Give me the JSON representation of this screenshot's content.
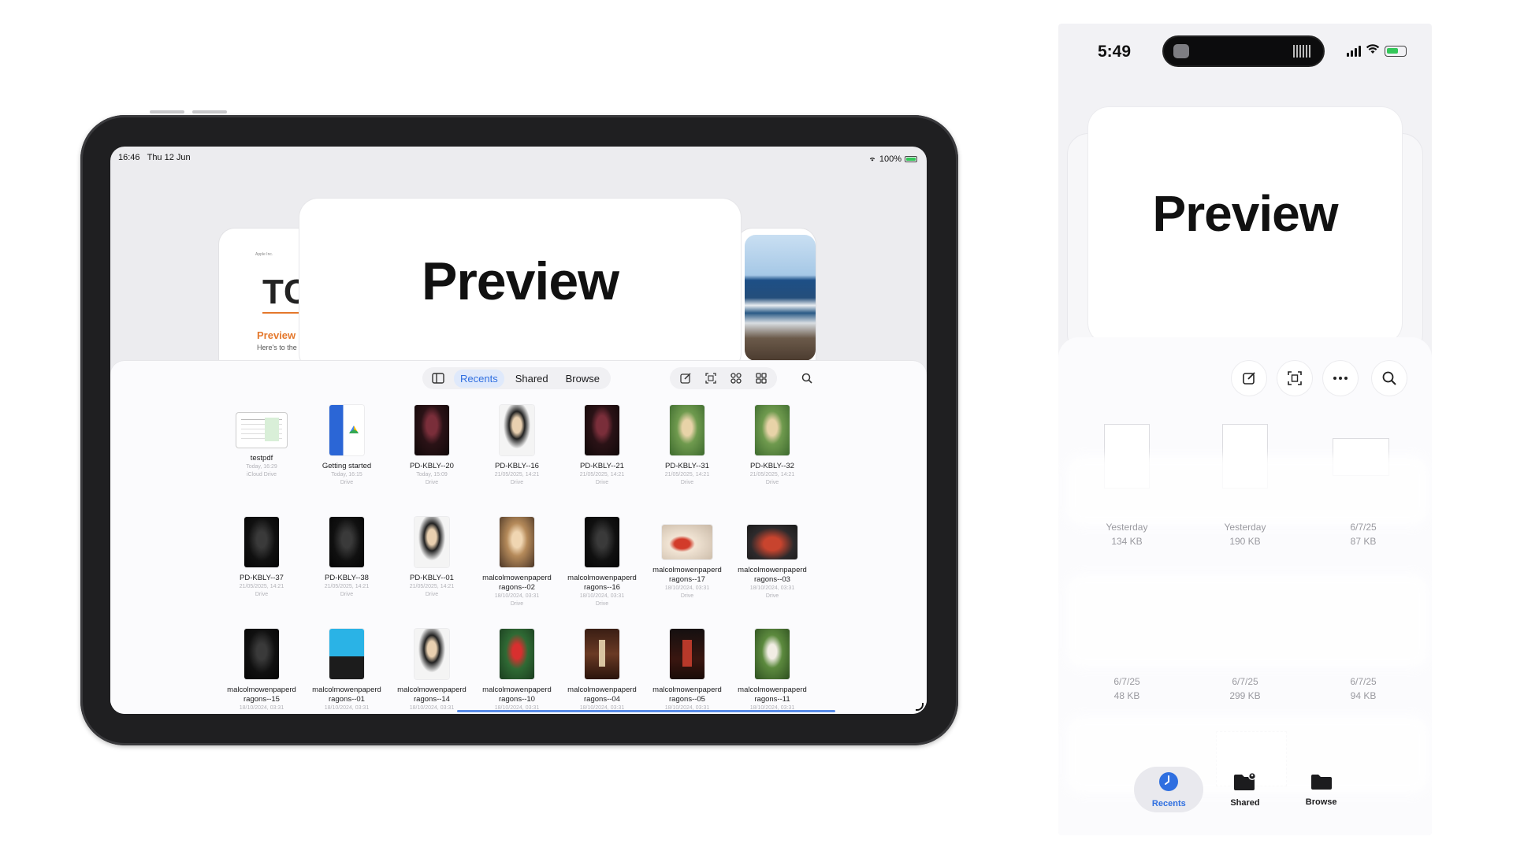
{
  "ipad": {
    "status": {
      "time": "16:46",
      "date": "Thu 12 Jun",
      "battery": "100%"
    },
    "left_card": {
      "small": "Apple Inc.",
      "big": "TC",
      "orange": "Preview",
      "sub": "Here's to the"
    },
    "center_card_title": "Preview",
    "toolbar": {
      "sidebar_icon": "sidebar-icon",
      "tabs": [
        "Recents",
        "Shared",
        "Browse"
      ],
      "active_tab": "Recents",
      "actions": [
        "compose-icon",
        "scan-icon",
        "group-icon",
        "grid-view-icon"
      ],
      "search_icon": "search-icon"
    },
    "files": [
      {
        "name": "testpdf",
        "meta1": "Today, 16:29",
        "meta2": "iCloud Drive"
      },
      {
        "name": "Getting started",
        "meta1": "Today, 16:15",
        "meta2": "Drive"
      },
      {
        "name": "PD-KBLY--20",
        "meta1": "Today, 15:09",
        "meta2": "Drive"
      },
      {
        "name": "PD-KBLY--16",
        "meta1": "21/05/2025, 14:21",
        "meta2": "Drive"
      },
      {
        "name": "PD-KBLY--21",
        "meta1": "21/05/2025, 14:21",
        "meta2": "Drive"
      },
      {
        "name": "PD-KBLY--31",
        "meta1": "21/05/2025, 14:21",
        "meta2": "Drive"
      },
      {
        "name": "PD-KBLY--32",
        "meta1": "21/05/2025, 14:21",
        "meta2": "Drive"
      },
      {
        "name": "PD-KBLY--37",
        "meta1": "21/05/2025, 14:21",
        "meta2": "Drive"
      },
      {
        "name": "PD-KBLY--38",
        "meta1": "21/05/2025, 14:21",
        "meta2": "Drive"
      },
      {
        "name": "PD-KBLY--01",
        "meta1": "21/05/2025, 14:21",
        "meta2": "Drive"
      },
      {
        "name": "malcolmowenpaperd ragons--02",
        "meta1": "18/10/2024, 03:31",
        "meta2": "Drive"
      },
      {
        "name": "malcolmowenpaperd ragons--16",
        "meta1": "18/10/2024, 03:31",
        "meta2": "Drive"
      },
      {
        "name": "malcolmowenpaperd ragons--17",
        "meta1": "18/10/2024, 03:31",
        "meta2": "Drive"
      },
      {
        "name": "malcolmowenpaperd ragons--03",
        "meta1": "18/10/2024, 03:31",
        "meta2": "Drive"
      },
      {
        "name": "malcolmowenpaperd ragons--15",
        "meta1": "18/10/2024, 03:31",
        "meta2": ""
      },
      {
        "name": "malcolmowenpaperd ragons--01",
        "meta1": "18/10/2024, 03:31",
        "meta2": ""
      },
      {
        "name": "malcolmowenpaperd ragons--14",
        "meta1": "18/10/2024, 03:31",
        "meta2": ""
      },
      {
        "name": "malcolmowenpaperd ragons--10",
        "meta1": "18/10/2024, 03:31",
        "meta2": ""
      },
      {
        "name": "malcolmowenpaperd ragons--04",
        "meta1": "18/10/2024, 03:31",
        "meta2": ""
      },
      {
        "name": "malcolmowenpaperd ragons--05",
        "meta1": "18/10/2024, 03:31",
        "meta2": ""
      },
      {
        "name": "malcolmowenpaperd ragons--11",
        "meta1": "18/10/2024, 03:31",
        "meta2": ""
      }
    ]
  },
  "iphone": {
    "status": {
      "time": "5:49"
    },
    "card_title": "Preview",
    "toolbar": [
      "compose-icon",
      "scan-icon",
      "more-icon",
      "search-icon"
    ],
    "items": [
      {
        "date": "Yesterday",
        "size": "134 KB"
      },
      {
        "date": "Yesterday",
        "size": "190 KB"
      },
      {
        "date": "6/7/25",
        "size": "87 KB"
      },
      {
        "date": "6/7/25",
        "size": "48 KB"
      },
      {
        "date": "6/7/25",
        "size": "299 KB"
      },
      {
        "date": "6/7/25",
        "size": "94 KB"
      }
    ],
    "tabs": [
      {
        "label": "Recents",
        "icon": "clock-icon",
        "active": true
      },
      {
        "label": "Shared",
        "icon": "shared-folder-icon",
        "active": false
      },
      {
        "label": "Browse",
        "icon": "folder-icon",
        "active": false
      }
    ]
  },
  "colors": {
    "accent": "#2f6fe0",
    "battery_green": "#34c759",
    "preview_orange": "#e4782c"
  }
}
